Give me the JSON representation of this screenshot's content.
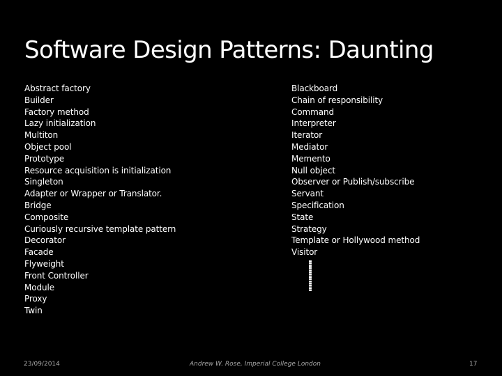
{
  "slide": {
    "title": "Software Design Patterns: Daunting",
    "left_column": [
      "Abstract factory",
      "Builder",
      "Factory method",
      "Lazy initialization",
      "Multiton",
      "Object pool",
      "Prototype",
      "Resource acquisition is initialization",
      "Singleton",
      "Adapter or Wrapper or Translator.",
      "Bridge",
      "Composite",
      "Curiously recursive template pattern",
      "Decorator",
      "Facade",
      "Flyweight",
      "Front Controller",
      "Module",
      "Proxy",
      "Twin"
    ],
    "right_column": [
      "Blackboard",
      "Chain of responsibility",
      "Command",
      "Interpreter",
      "Iterator",
      "Mediator",
      "Memento",
      "Null object",
      "Observer or Publish/subscribe",
      "Servant",
      "Specification",
      "State",
      "Strategy",
      "Template or Hollywood method",
      "Visitor"
    ],
    "continuation_icon": "vertical-ellipsis-icon"
  },
  "footer": {
    "date": "23/09/2014",
    "author": "Andrew W. Rose, Imperial College London",
    "page_number": "17"
  },
  "colors": {
    "background": "#000000",
    "text": "#ffffff",
    "footer_text": "#a6a6a6"
  }
}
